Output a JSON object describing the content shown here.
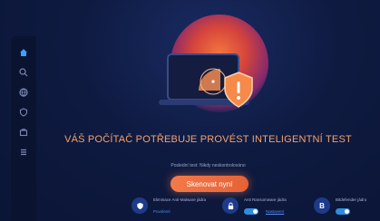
{
  "main": {
    "title": "VÁŠ POČÍTAČ POTŘEBUJE PROVÉST INTELIGENTNÍ TEST",
    "last_test": "Poslední test: Nikdy neskontrolováno",
    "scan_button": "Skenovat nyní"
  },
  "features": [
    {
      "label": "Eliminace Anti-Malware jádra",
      "link": "Povolené",
      "icon": "shield-icon",
      "toggle": true
    },
    {
      "label": "Anti Ransomware jádra",
      "link": "Nastavení",
      "icon": "lock-icon",
      "toggle": true
    },
    {
      "label": "Bitdefender jádro",
      "link": "",
      "icon": "b-icon",
      "icon_letter": "B",
      "toggle": true
    }
  ],
  "sidebar": {
    "items": [
      {
        "icon": "home-icon"
      },
      {
        "icon": "search-icon"
      },
      {
        "icon": "globe-icon"
      },
      {
        "icon": "shield-icon"
      },
      {
        "icon": "briefcase-icon"
      },
      {
        "icon": "list-icon"
      }
    ]
  },
  "colors": {
    "background": "#0c1637",
    "accent": "#f47a4a",
    "title": "#f6a26a",
    "link": "#4f8cf0",
    "toggle": "#2f8de0"
  }
}
